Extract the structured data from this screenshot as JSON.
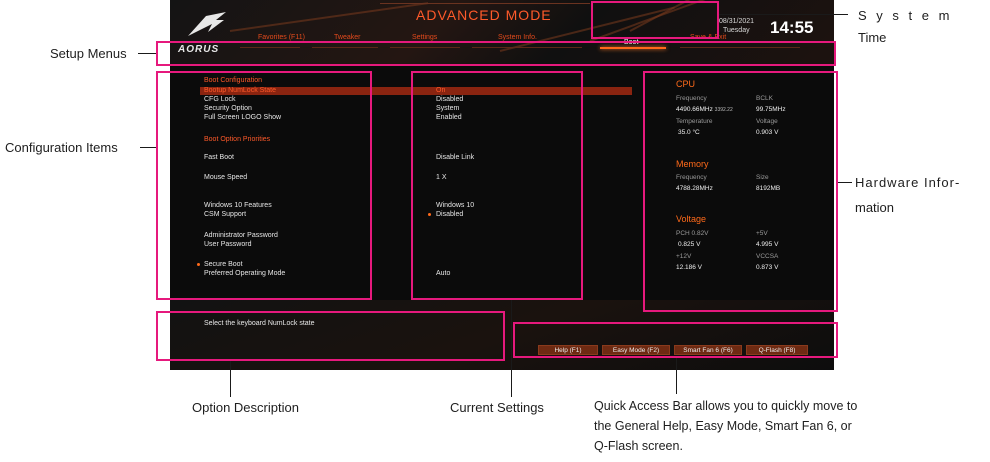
{
  "header": {
    "mode_title": "ADVANCED MODE",
    "brand": "AORUS",
    "date": "08/31/2021",
    "day": "Tuesday",
    "time": "14:55"
  },
  "menu": {
    "items": [
      "Favorites (F11)",
      "Tweaker",
      "Settings",
      "System Info.",
      "Boot",
      "Save & Exit"
    ],
    "active": "Boot"
  },
  "config": {
    "section_boot": "Boot Configuration",
    "rows": [
      {
        "label": "Bootup NumLock State",
        "value": "On"
      },
      {
        "label": "CFG Lock",
        "value": "Disabled"
      },
      {
        "label": "Security Option",
        "value": "System"
      },
      {
        "label": "Full Screen LOGO Show",
        "value": "Enabled"
      }
    ],
    "section_priorities": "Boot Option Priorities",
    "fast_boot": {
      "label": "Fast Boot",
      "value": "Disable Link"
    },
    "mouse_speed": {
      "label": "Mouse Speed",
      "value": "1 X"
    },
    "win10": {
      "label": "Windows 10 Features",
      "value": "Windows 10"
    },
    "csm": {
      "label": "CSM Support",
      "value": "Disabled"
    },
    "admin_pw": {
      "label": "Administrator Password"
    },
    "user_pw": {
      "label": "User Password"
    },
    "secure_boot": {
      "label": "Secure Boot"
    },
    "preferred_mode": {
      "label": "Preferred Operating Mode",
      "value": "Auto"
    }
  },
  "hardware": {
    "cpu": {
      "title": "CPU",
      "freq_label": "Frequency",
      "freq": "4490.66MHz",
      "freq_extra": "3392.22",
      "bclk_label": "BCLK",
      "bclk": "99.75MHz",
      "temp_label": "Temperature",
      "temp": "35.0 °C",
      "volt_label": "Voltage",
      "volt": "0.903 V"
    },
    "memory": {
      "title": "Memory",
      "freq_label": "Frequency",
      "freq": "4788.28MHz",
      "size_label": "Size",
      "size": "8192MB"
    },
    "voltage": {
      "title": "Voltage",
      "pch_label": "PCH 0.82V",
      "pch": "0.825 V",
      "v5_label": "+5V",
      "v5": "4.995 V",
      "v12_label": "+12V",
      "v12": "12.186 V",
      "vccsa_label": "VCCSA",
      "vccsa": "0.873 V"
    }
  },
  "description": "Select the keyboard NumLock state",
  "quick_access": {
    "help": "Help (F1)",
    "easy": "Easy Mode (F2)",
    "fan": "Smart Fan 6 (F6)",
    "qflash": "Q-Flash (F8)"
  },
  "callouts": {
    "system_time_1": "S y s t e m",
    "system_time_2": "Time",
    "setup_menus": "Setup Menus",
    "config_items": "Configuration Items",
    "hardware_info_1": "Hardware Infor-",
    "hardware_info_2": "mation",
    "option_desc": "Option Description",
    "current_settings": "Current Settings",
    "quick_access_1": "Quick Access Bar allows you to quickly move to",
    "quick_access_2": "the General Help, Easy Mode, Smart Fan 6, or",
    "quick_access_3": "Q-Flash screen."
  },
  "colors": {
    "accent": "#ff5a2a",
    "callout_box": "#e6197d",
    "background": "#0b0b0b"
  }
}
